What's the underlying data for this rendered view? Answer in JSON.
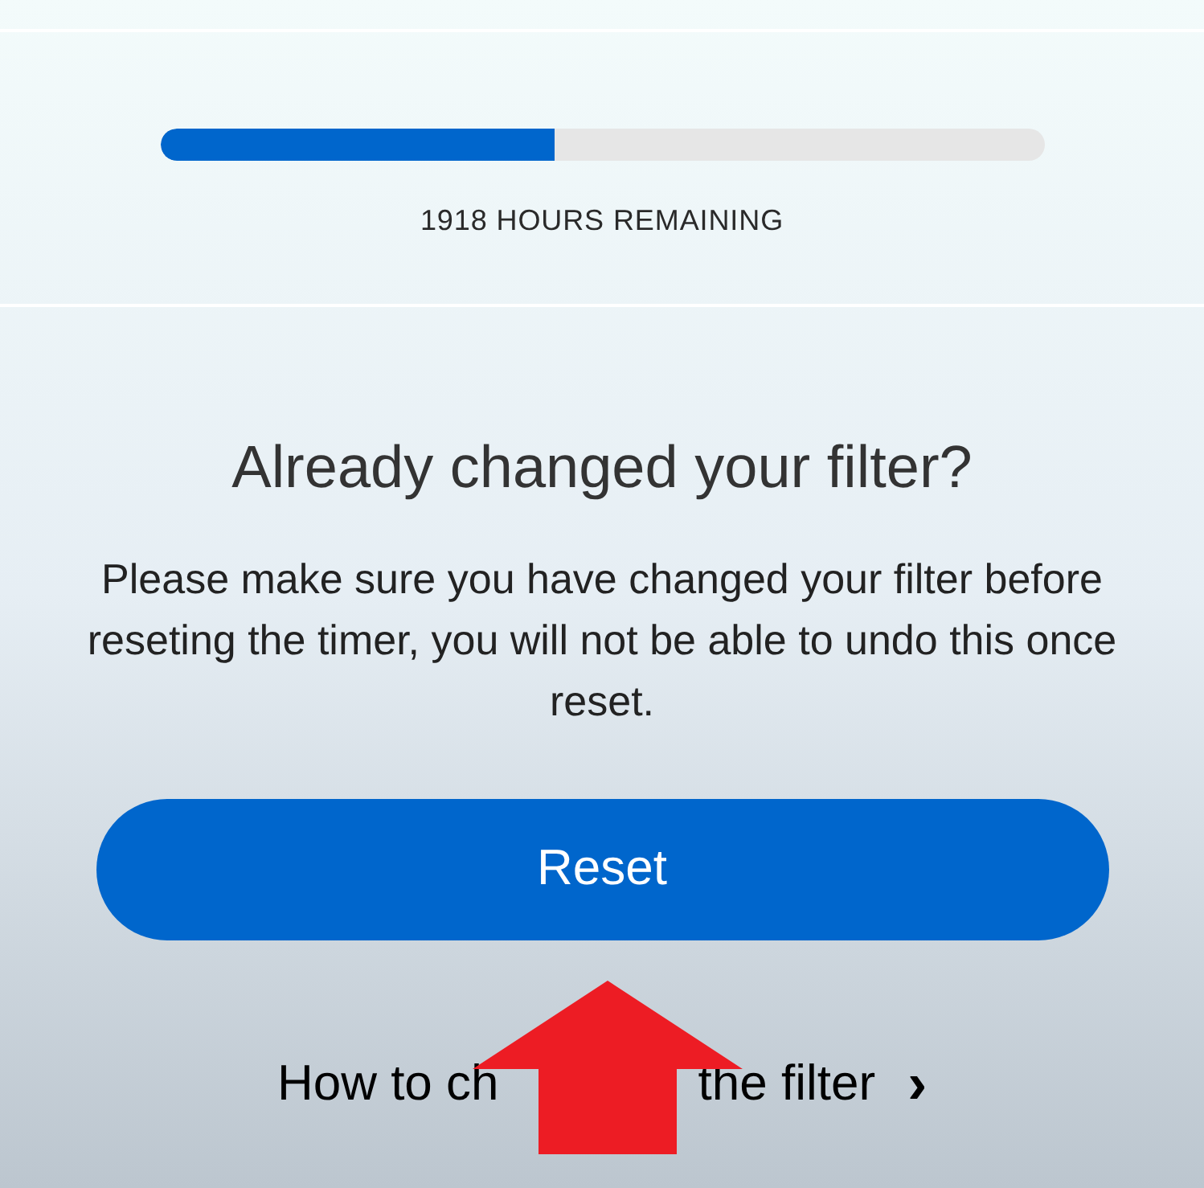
{
  "filter_life": {
    "level": 0.447,
    "reading": "1918 HOURS REMAINING"
  },
  "heading": "Already changed your filter?",
  "message": "Please make sure you have changed your filter before reseting the timer, you will not be able to undo this once reset.",
  "reset_button": "Reset",
  "help_link": {
    "visible_parts": [
      "How to ch",
      "the filter"
    ],
    "chevron": "›"
  }
}
